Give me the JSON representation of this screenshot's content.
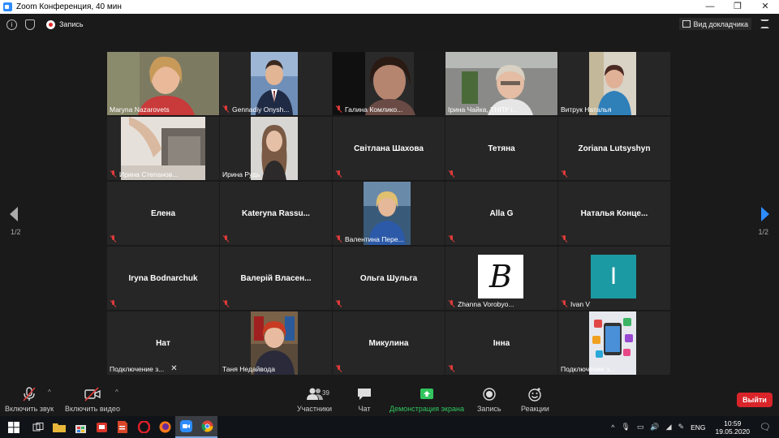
{
  "window": {
    "title": "Zoom Конференция, 40 мин",
    "controls": [
      "—",
      "❐",
      "✕"
    ]
  },
  "topbar": {
    "info_icon": "i",
    "record_label": "Запись",
    "speaker_view_label": "Вид докладчика"
  },
  "pager": {
    "left_label": "1/2",
    "right_label": "1/2"
  },
  "tiles": [
    {
      "name": "Maryna Nazarovets",
      "type": "video",
      "muted": false,
      "active": true
    },
    {
      "name": "Gennadiy Onysh...",
      "type": "photo",
      "muted": true
    },
    {
      "name": "Галина Комлико...",
      "type": "video",
      "muted": true
    },
    {
      "name": "Ірина Чайка, ТНПУ і...",
      "type": "video",
      "muted": false
    },
    {
      "name": "Витрук Наталья",
      "type": "photo",
      "muted": false
    },
    {
      "name": "Ирина Степанов...",
      "type": "video",
      "muted": true
    },
    {
      "name": "Ирина Рудь",
      "type": "photo",
      "muted": false
    },
    {
      "name": "Світлана Шахова",
      "type": "name",
      "muted": true
    },
    {
      "name": "Тетяна",
      "type": "name",
      "muted": true
    },
    {
      "name": "Zoriana Lutsyshyn",
      "type": "name",
      "muted": true
    },
    {
      "name": "Елена",
      "type": "name",
      "muted": true
    },
    {
      "name": "Kateryna  Rassu...",
      "type": "name",
      "muted": true
    },
    {
      "name": "Валентина Пере...",
      "type": "photo",
      "muted": true
    },
    {
      "name": "Alla G",
      "type": "name",
      "muted": true
    },
    {
      "name": "Наталья  Конце...",
      "type": "name",
      "muted": true
    },
    {
      "name": "Iryna Bodnarchuk",
      "type": "name",
      "muted": true
    },
    {
      "name": "Валерій  Власен...",
      "type": "name",
      "muted": true
    },
    {
      "name": "Ольга Шульга",
      "type": "name",
      "muted": true
    },
    {
      "name": "Zhanna Vorobyo...",
      "type": "logo-b",
      "muted": true,
      "logo_letter": "B"
    },
    {
      "name": "Ivan V",
      "type": "letter",
      "muted": true,
      "letter": "I"
    },
    {
      "name": "Нат",
      "type": "name",
      "muted": false,
      "caption": "Подключение з...",
      "closable": true
    },
    {
      "name": "Таня Недайвода",
      "type": "photo",
      "muted": false
    },
    {
      "name": "Микулина",
      "type": "name",
      "muted": true
    },
    {
      "name": "Інна",
      "type": "name",
      "muted": true
    },
    {
      "name": "Подключение з...",
      "type": "apps",
      "muted": false
    }
  ],
  "toolbar": {
    "mute_label": "Включить звук",
    "video_label": "Включить видео",
    "participants_label": "Участники",
    "participants_count": "39",
    "chat_label": "Чат",
    "share_label": "Демонстрация экрана",
    "record_label": "Запись",
    "reactions_label": "Реакции",
    "leave_label": "Выйти"
  },
  "taskbar": {
    "lang": "ENG",
    "time": "10:59",
    "date": "19.05.2020"
  },
  "colors": {
    "active_speaker": "#b6df4f",
    "share_green": "#32c55f",
    "leave_red": "#d9252a",
    "accent_blue": "#2d8cff"
  }
}
